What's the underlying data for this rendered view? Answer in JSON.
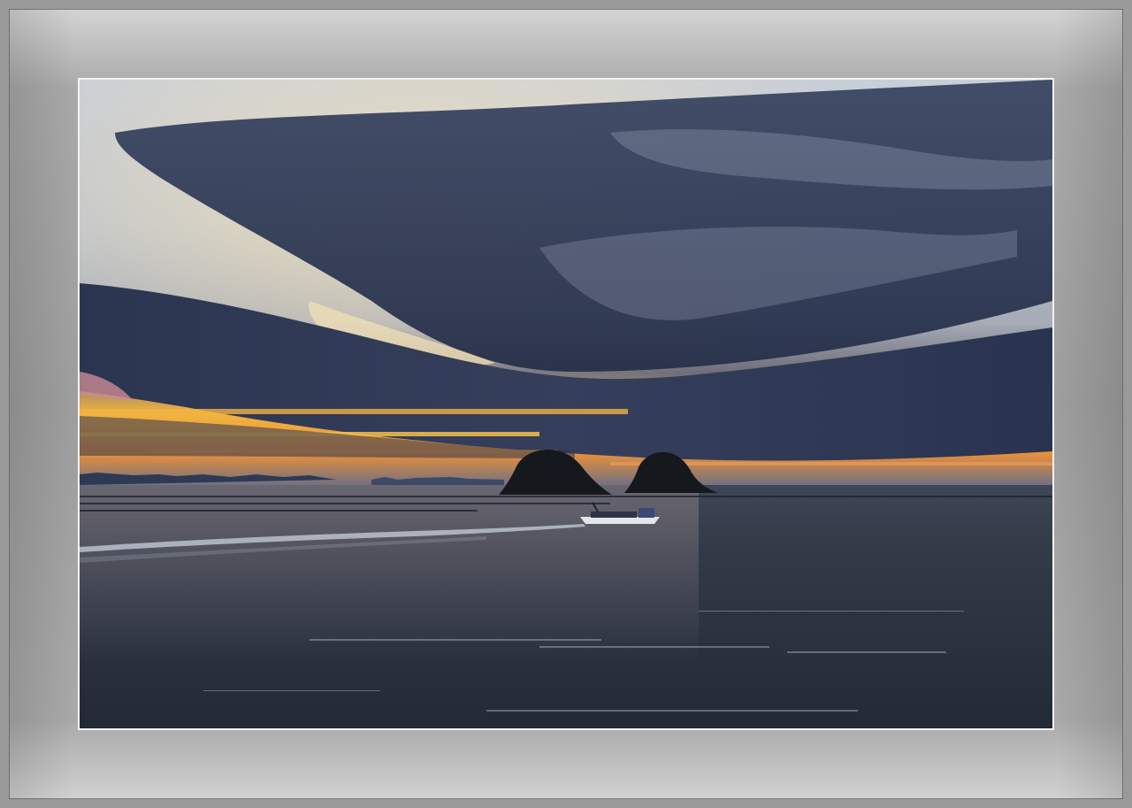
{
  "image": {
    "subject": "sunset-seascape",
    "colors": {
      "frame": "#9a9a9a",
      "mat_light": "#d4d4d4",
      "mat_mid": "#9e9e9e",
      "photo_border": "#f2f2f2",
      "sky_top": "#c6ccd4",
      "cloud_dark": "#2f3a55",
      "horizon_gold": "#f4b63a",
      "sea": "#2c3442"
    }
  }
}
